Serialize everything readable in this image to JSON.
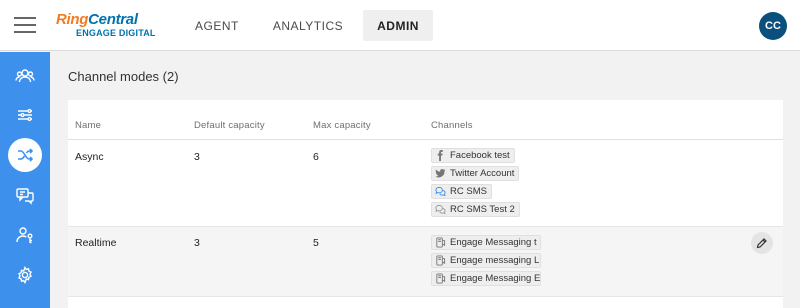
{
  "logo": {
    "ring": "Ring",
    "central": "Central",
    "sub": "ENGAGE DIGITAL"
  },
  "nav": {
    "tabs": [
      {
        "label": "AGENT"
      },
      {
        "label": "ANALYTICS"
      },
      {
        "label": "ADMIN"
      }
    ],
    "active": "ADMIN"
  },
  "user": {
    "initials": "CC"
  },
  "sidebar": {
    "items": [
      {
        "icon": "users-icon"
      },
      {
        "icon": "sliders-icon"
      },
      {
        "icon": "shuffle-icon",
        "active": true
      },
      {
        "icon": "chat-bubbles-icon"
      },
      {
        "icon": "user-key-icon"
      },
      {
        "icon": "gear-icon"
      }
    ]
  },
  "page": {
    "title": "Channel modes (2)"
  },
  "table": {
    "headers": {
      "name": "Name",
      "default_capacity": "Default capacity",
      "max_capacity": "Max capacity",
      "channels": "Channels"
    },
    "rows": [
      {
        "name": "Async",
        "default_capacity": "3",
        "max_capacity": "6",
        "channels": [
          {
            "icon": "facebook-icon",
            "label": "Facebook test"
          },
          {
            "icon": "twitter-icon",
            "label": "Twitter Account"
          },
          {
            "icon": "sms-icon",
            "label": "RC SMS"
          },
          {
            "icon": "sms-icon",
            "label": "RC SMS Test 2"
          }
        ]
      },
      {
        "name": "Realtime",
        "default_capacity": "3",
        "max_capacity": "5",
        "channels": [
          {
            "icon": "messaging-icon",
            "label": "Engage Messaging t"
          },
          {
            "icon": "messaging-icon",
            "label": "Engage messaging L"
          },
          {
            "icon": "messaging-icon",
            "label": "Engage Messaging E"
          }
        ]
      }
    ]
  },
  "colors": {
    "accent": "#3d90ec",
    "avatar": "#0b4f7c",
    "logo_orange": "#f47a20",
    "logo_blue": "#0073ae"
  }
}
